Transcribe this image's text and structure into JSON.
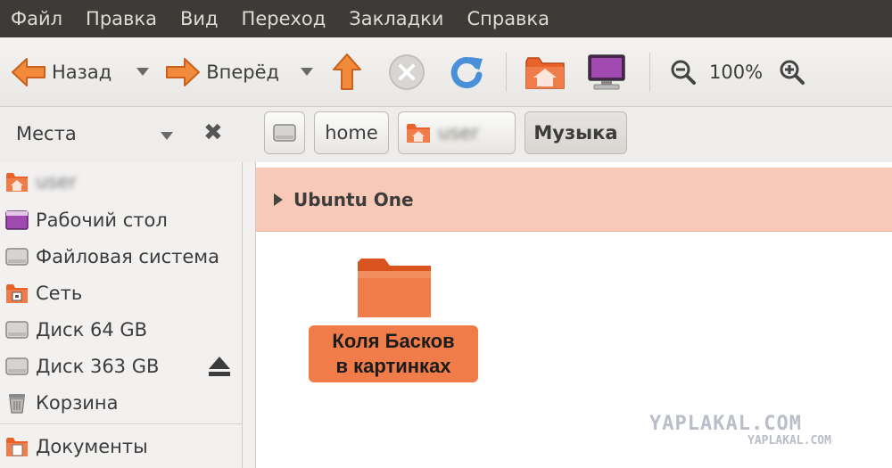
{
  "menubar": {
    "items": [
      "Файл",
      "Правка",
      "Вид",
      "Переход",
      "Закладки",
      "Справка"
    ]
  },
  "toolbar": {
    "back_label": "Назад",
    "forward_label": "Вперёд",
    "zoom_value": "100%"
  },
  "places": {
    "label": "Места"
  },
  "breadcrumb": {
    "home_label": "home",
    "user_label": "user",
    "current_label": "Музыка"
  },
  "sidebar": {
    "items": [
      {
        "label": "user",
        "icon": "home-folder-icon"
      },
      {
        "label": "Рабочий стол",
        "icon": "desktop-icon"
      },
      {
        "label": "Файловая система",
        "icon": "drive-icon"
      },
      {
        "label": "Сеть",
        "icon": "network-icon"
      },
      {
        "label": "Диск 64 GB",
        "icon": "drive-icon"
      },
      {
        "label": "Диск 363 GB",
        "icon": "drive-icon"
      },
      {
        "label": "Корзина",
        "icon": "trash-icon"
      },
      {
        "label": "Документы",
        "icon": "documents-icon"
      }
    ]
  },
  "main": {
    "ubuntu_one_label": "Ubuntu One",
    "folder_label_line1": "Коля Басков",
    "folder_label_line2": "в картинках"
  },
  "watermark": {
    "large": "YAPLAKAL.COM",
    "small": "YAPLAKAL.COM"
  },
  "colors": {
    "accent": "#f07c4a",
    "menubar": "#3c3b37",
    "banner": "#f7c9b6"
  }
}
